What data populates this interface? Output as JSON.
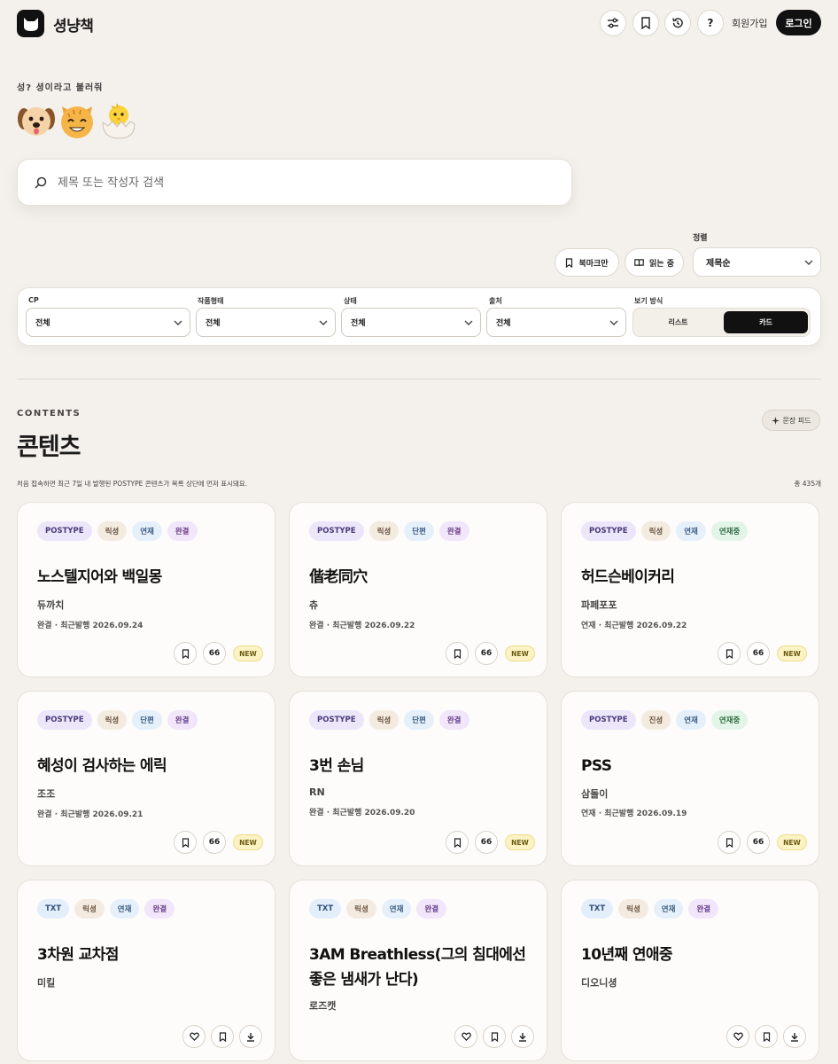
{
  "header": {
    "brand": "셩냥책",
    "help_label": "?",
    "signup_label": "회원가입",
    "login_label": "로그인"
  },
  "tagline": "성? 셩이라고 불러줘",
  "search": {
    "placeholder": "제목 또는 작성자 검색"
  },
  "toolbar": {
    "bookmark_only": "북마크만",
    "reading": "읽는 중",
    "sort_label": "정렬",
    "sort_value": "제목순"
  },
  "filters": {
    "cp_label": "CP",
    "cp_value": "전체",
    "form_label": "작품형태",
    "form_value": "전체",
    "status_label": "상태",
    "status_value": "전체",
    "source_label": "출처",
    "source_value": "전체",
    "view_label": "보기 방식",
    "view_list": "리스트",
    "view_card": "카드"
  },
  "section": {
    "eyebrow": "CONTENTS",
    "title": "콘텐츠",
    "feed_button": "문장 피드",
    "notice": "처음 접속하면 최근 7일 내 발행된 POSTYPE 콘텐츠가 목록 상단에 먼저 표시돼요.",
    "total": "총 435개"
  },
  "cards": [
    {
      "source": "POSTYPE",
      "cp": "릭셩",
      "form": "연재",
      "status": "완결",
      "title": "노스텔지어와 백일몽",
      "author": "듀까치",
      "meta": "완결 · 최근발행 2026.09.24",
      "quote": "66",
      "new": "NEW"
    },
    {
      "source": "POSTYPE",
      "cp": "릭셩",
      "form": "단편",
      "status": "완결",
      "title": "偕老同穴",
      "author": "츄",
      "meta": "완결 · 최근발행 2026.09.22",
      "quote": "66",
      "new": "NEW"
    },
    {
      "source": "POSTYPE",
      "cp": "릭셩",
      "form": "연재",
      "status": "연재중",
      "title": "허드슨베이커리",
      "author": "파페포포",
      "meta": "연재 · 최근발행 2026.09.22",
      "quote": "66",
      "new": "NEW"
    },
    {
      "source": "POSTYPE",
      "cp": "릭셩",
      "form": "단편",
      "status": "완결",
      "title": "혜성이 검사하는 에릭",
      "author": "조조",
      "meta": "완결 · 최근발행 2026.09.21",
      "quote": "66",
      "new": "NEW"
    },
    {
      "source": "POSTYPE",
      "cp": "릭셩",
      "form": "단편",
      "status": "완결",
      "title": "3번 손님",
      "author": "RN",
      "meta": "완결 · 최근발행 2026.09.20",
      "quote": "66",
      "new": "NEW"
    },
    {
      "source": "POSTYPE",
      "cp": "진셩",
      "form": "연재",
      "status": "연재중",
      "title": "PSS",
      "author": "삼돌이",
      "meta": "연재 · 최근발행 2026.09.19",
      "quote": "66",
      "new": "NEW"
    },
    {
      "source": "TXT",
      "cp": "릭셩",
      "form": "연재",
      "status": "완결",
      "title": "3차원 교차점",
      "author": "미킬"
    },
    {
      "source": "TXT",
      "cp": "릭셩",
      "form": "연재",
      "status": "완결",
      "title": "3AM Breathless(그의 침대에선 좋은 냄새가 난다)",
      "author": "로즈캣"
    },
    {
      "source": "TXT",
      "cp": "릭셩",
      "form": "연재",
      "status": "완결",
      "title": "10년째 연애중",
      "author": "디오니셩"
    }
  ]
}
